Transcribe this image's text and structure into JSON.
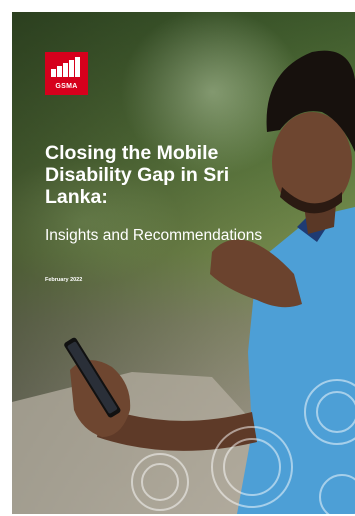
{
  "logo": {
    "text": "GSMA",
    "brand_color": "#d6001c"
  },
  "cover": {
    "title": "Closing the Mobile Disability Gap in Sri Lanka:",
    "subtitle": "Insights and Recommendations",
    "date": "February 2022"
  },
  "colors": {
    "text": "#ffffff",
    "shirt": "#4d9fd6",
    "skin": "#6e4630"
  }
}
